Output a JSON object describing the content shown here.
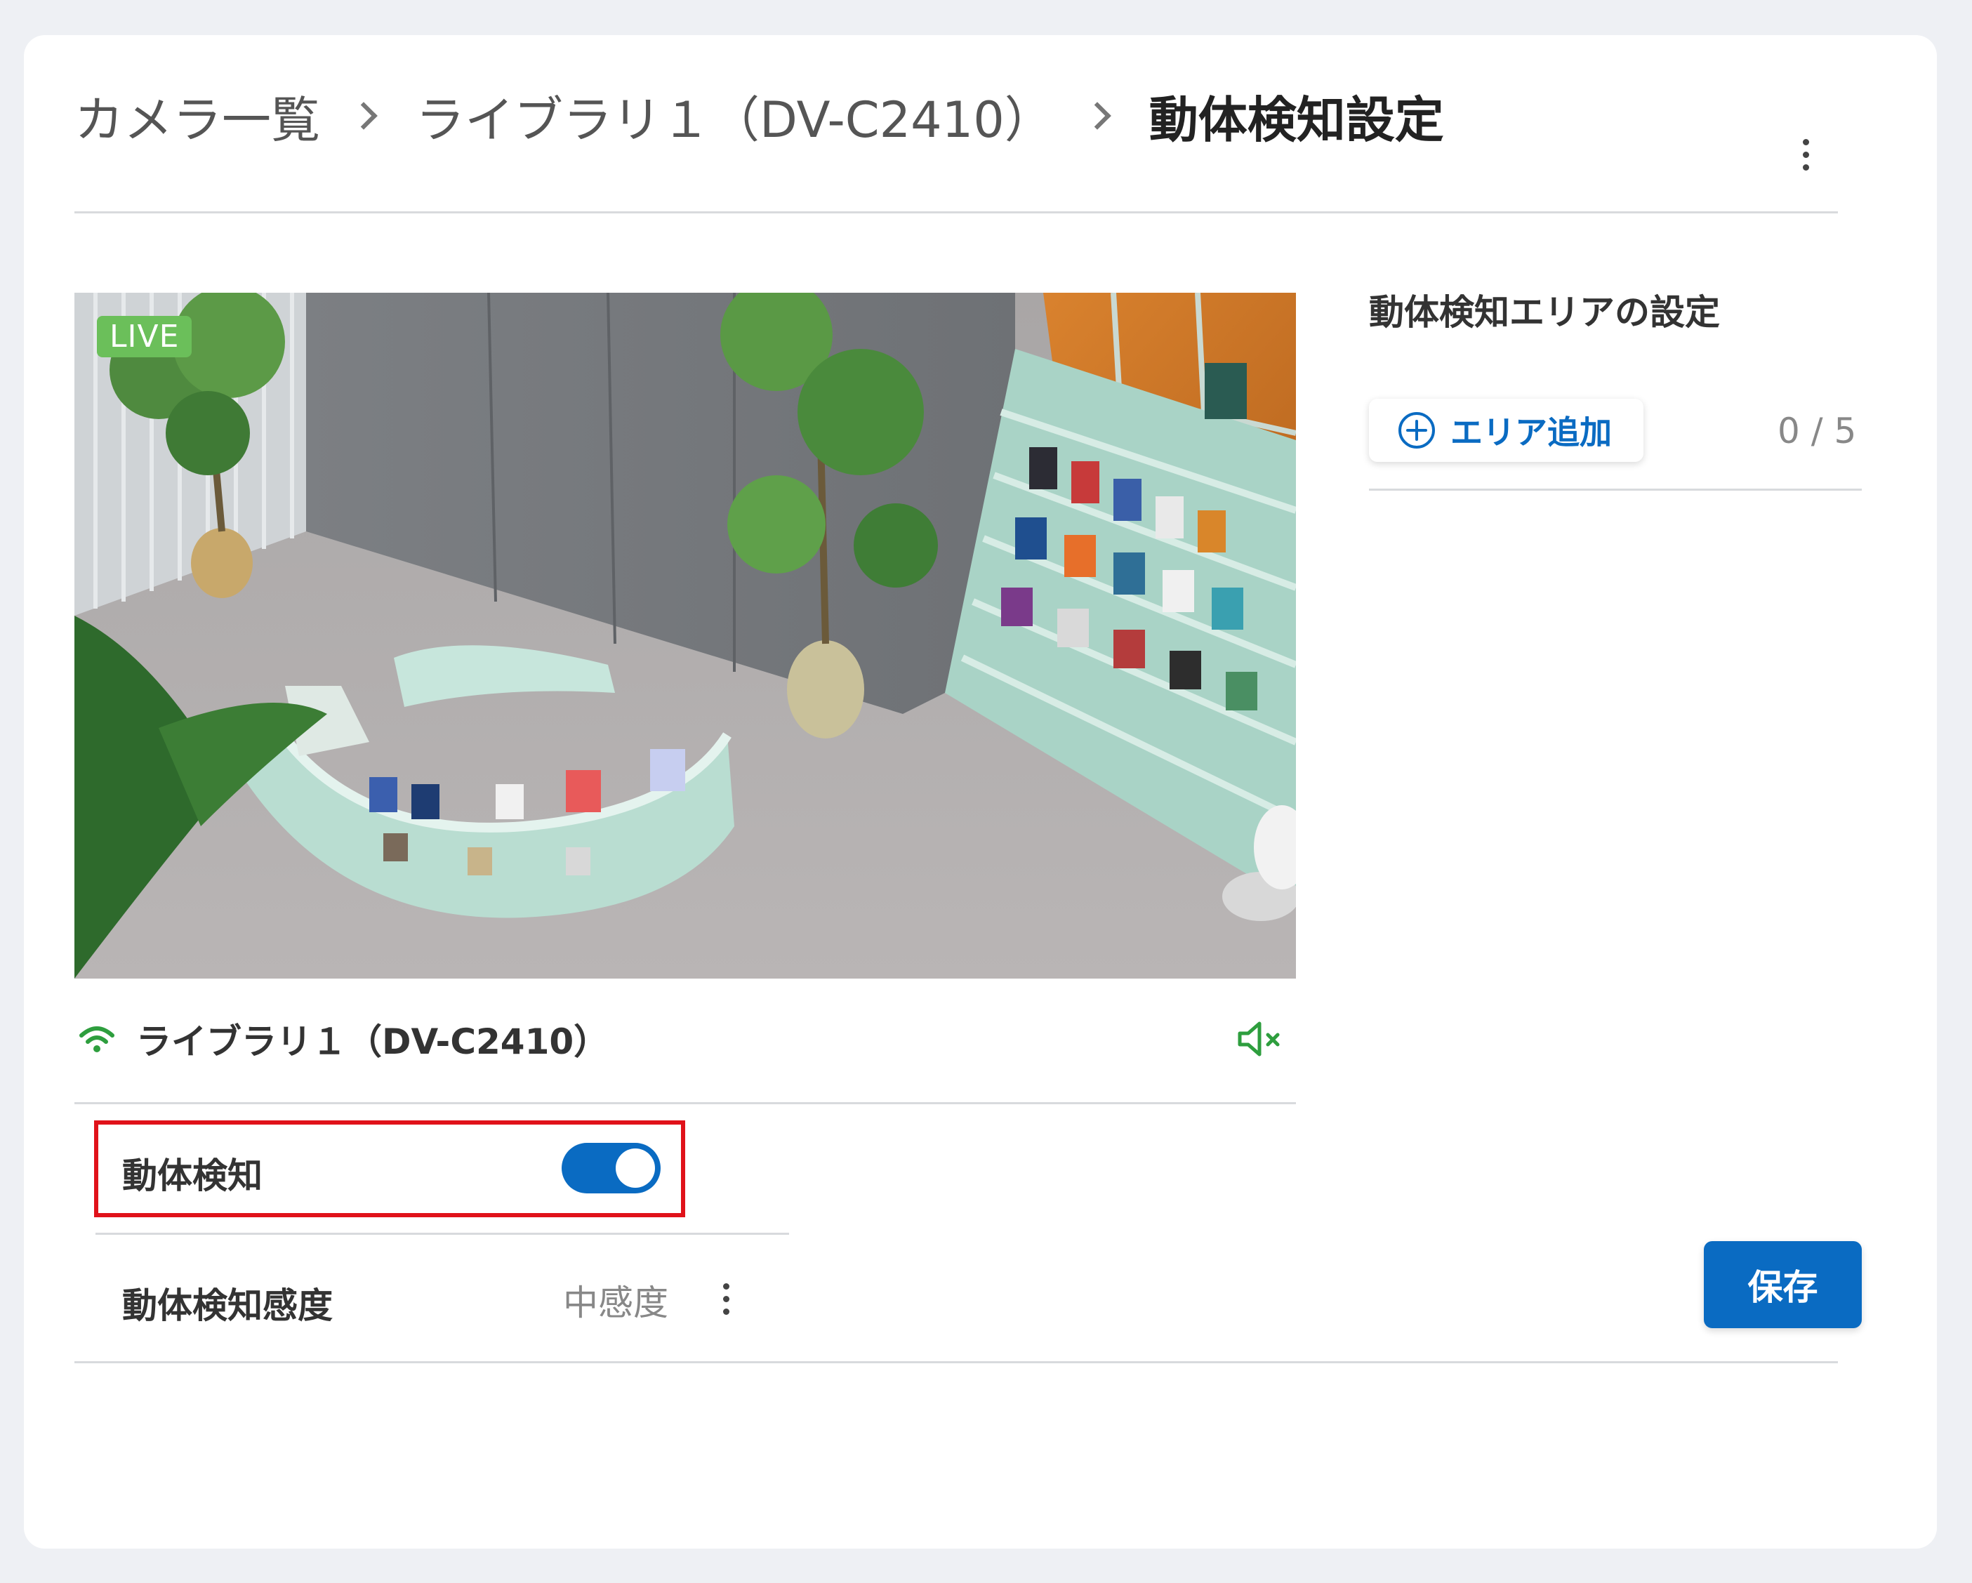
{
  "breadcrumb": {
    "camera_list": "カメラ一覧",
    "camera": "ライブラリ１（DV-C2410）",
    "current": "動体検知設定"
  },
  "camera_view": {
    "live_badge": "LIVE",
    "camera_name": "ライブラリ１（DV-C2410）"
  },
  "motion_detection": {
    "label": "動体検知",
    "enabled": true
  },
  "sensitivity": {
    "label": "動体検知感度",
    "value": "中感度"
  },
  "area_settings": {
    "title": "動体検知エリアの設定",
    "add_button": "エリア追加",
    "count": "0 / 5"
  },
  "actions": {
    "save": "保存"
  },
  "colors": {
    "primary": "#0a6bc2",
    "live_green": "#6bbf5a",
    "wifi_green": "#2e9e3e",
    "highlight_red": "#e0121a"
  },
  "icons": {
    "wifi": "wifi-icon",
    "mute": "speaker-muted-icon",
    "add": "plus-circle-icon",
    "more": "kebab-menu-icon"
  }
}
